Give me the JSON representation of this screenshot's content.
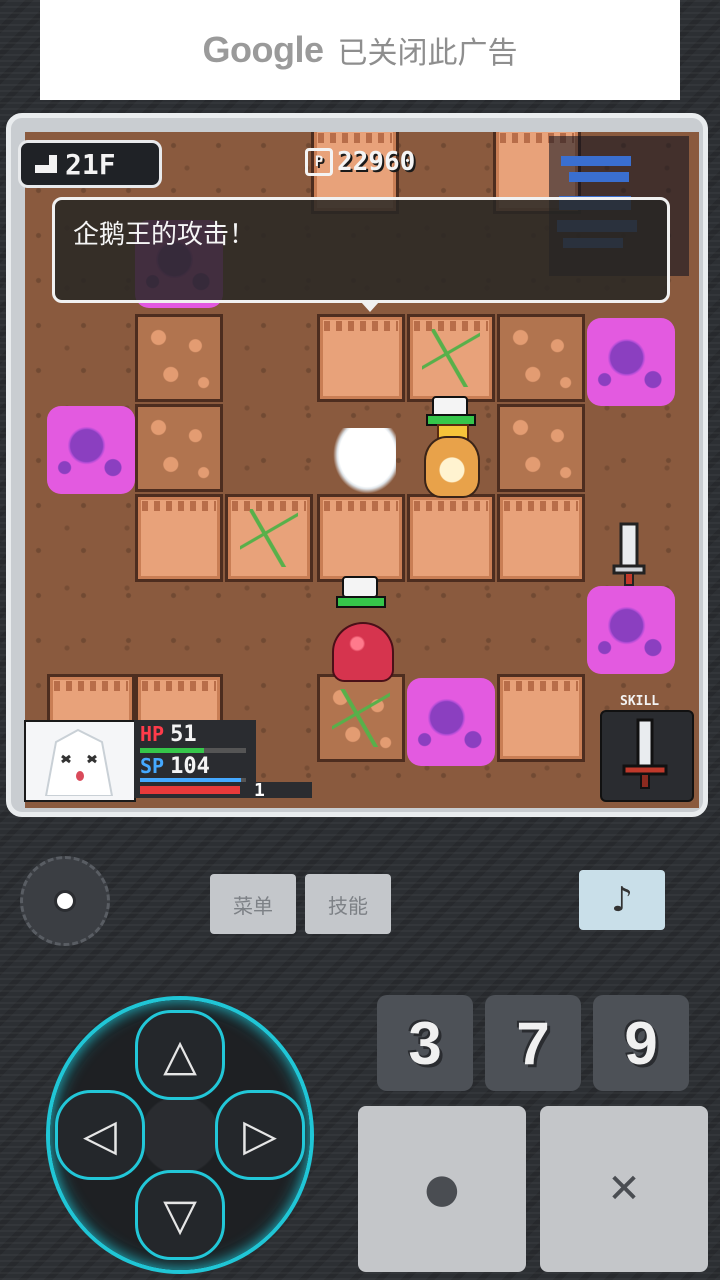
{
  "ad": {
    "brand": "Google",
    "message": "已关闭此广告"
  },
  "hud": {
    "floor": "21F",
    "points": "22960",
    "points_mark": "P",
    "dialog": "企鹅王的攻击！"
  },
  "player": {
    "hp_label": "HP",
    "hp": "51",
    "sp_label": "SP",
    "sp": "104",
    "level": "1"
  },
  "skill": {
    "label": "SKILL"
  },
  "controls": {
    "menu": "菜单",
    "skills": "技能",
    "music_icon": "♪",
    "keys": [
      "3",
      "7",
      "9"
    ],
    "confirm_icon": "●",
    "cancel_icon": "✕",
    "dpad": {
      "up": "△",
      "down": "▽",
      "left": "◁",
      "right": "▷"
    }
  },
  "colors": {
    "accent": "#20c6d6",
    "hp": "#ff3b4a",
    "sp": "#45a9ff"
  }
}
